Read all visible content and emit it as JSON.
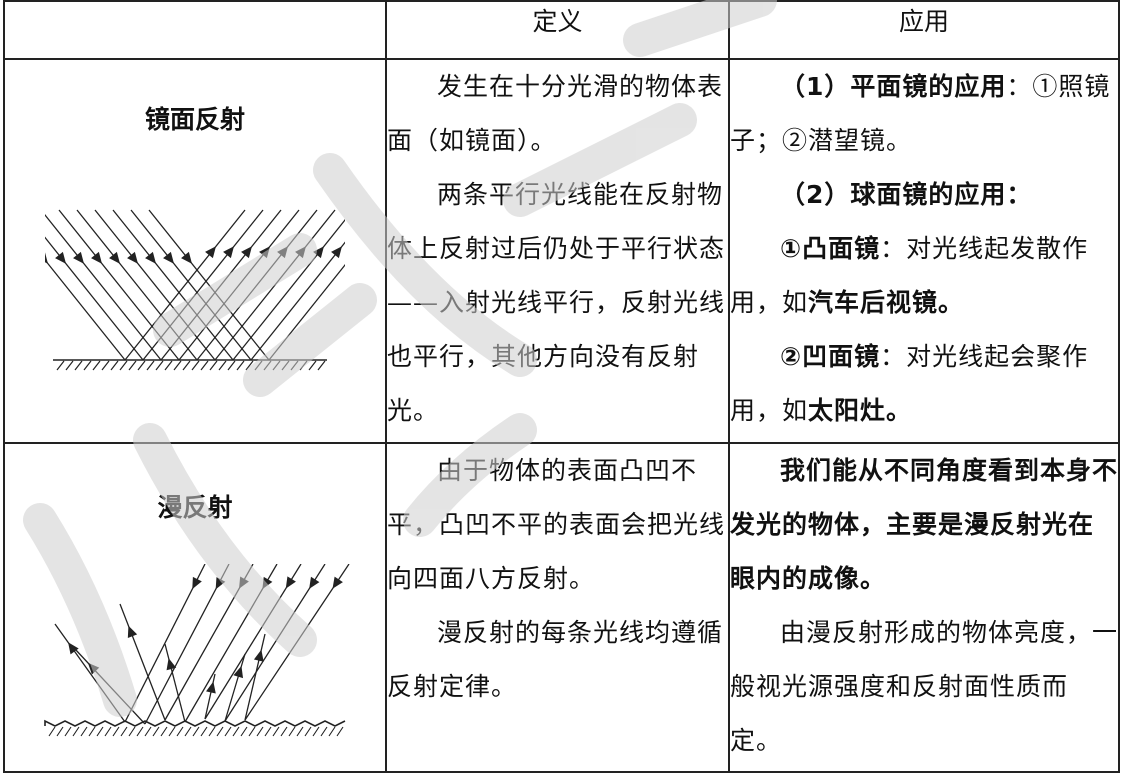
{
  "header": {
    "col1": "",
    "col2": "定义",
    "col3": "应用"
  },
  "rows": [
    {
      "label": "镜面反射",
      "definition": [
        "发生在十分光滑的物体表面（如镜面）。",
        "两条平行光线能在反射物体上反射过后仍处于平行状态——入射光线平行，反射光线也平行，其他方向没有反射光。"
      ],
      "application": {
        "p1_bold": "（1）平面镜的应用",
        "p1_rest": "：①照镜子；②潜望镜。",
        "p2_bold": "（2）球面镜的应用：",
        "p3_bold": "①凸面镜",
        "p3_mid": "：对光线起发散作用，如",
        "p3_bold2": "汽车后视镜。",
        "p4_bold": "②凹面镜",
        "p4_mid": "：对光线起会聚作用，如",
        "p4_bold2": "太阳灶。"
      }
    },
    {
      "label": "漫反射",
      "definition": [
        "由于物体的表面凸凹不平，凸凹不平的表面会把光线向四面八方反射。",
        "漫反射的每条光线均遵循反射定律。"
      ],
      "application": {
        "p1_bold": "我们能从不同角度看到本身不发光的物体，主要是漫反射光在眼内的成像。",
        "p2": "由漫反射形成的物体亮度，一般视光源强度和反射面性质而定。"
      }
    }
  ],
  "watermark": "八考网"
}
